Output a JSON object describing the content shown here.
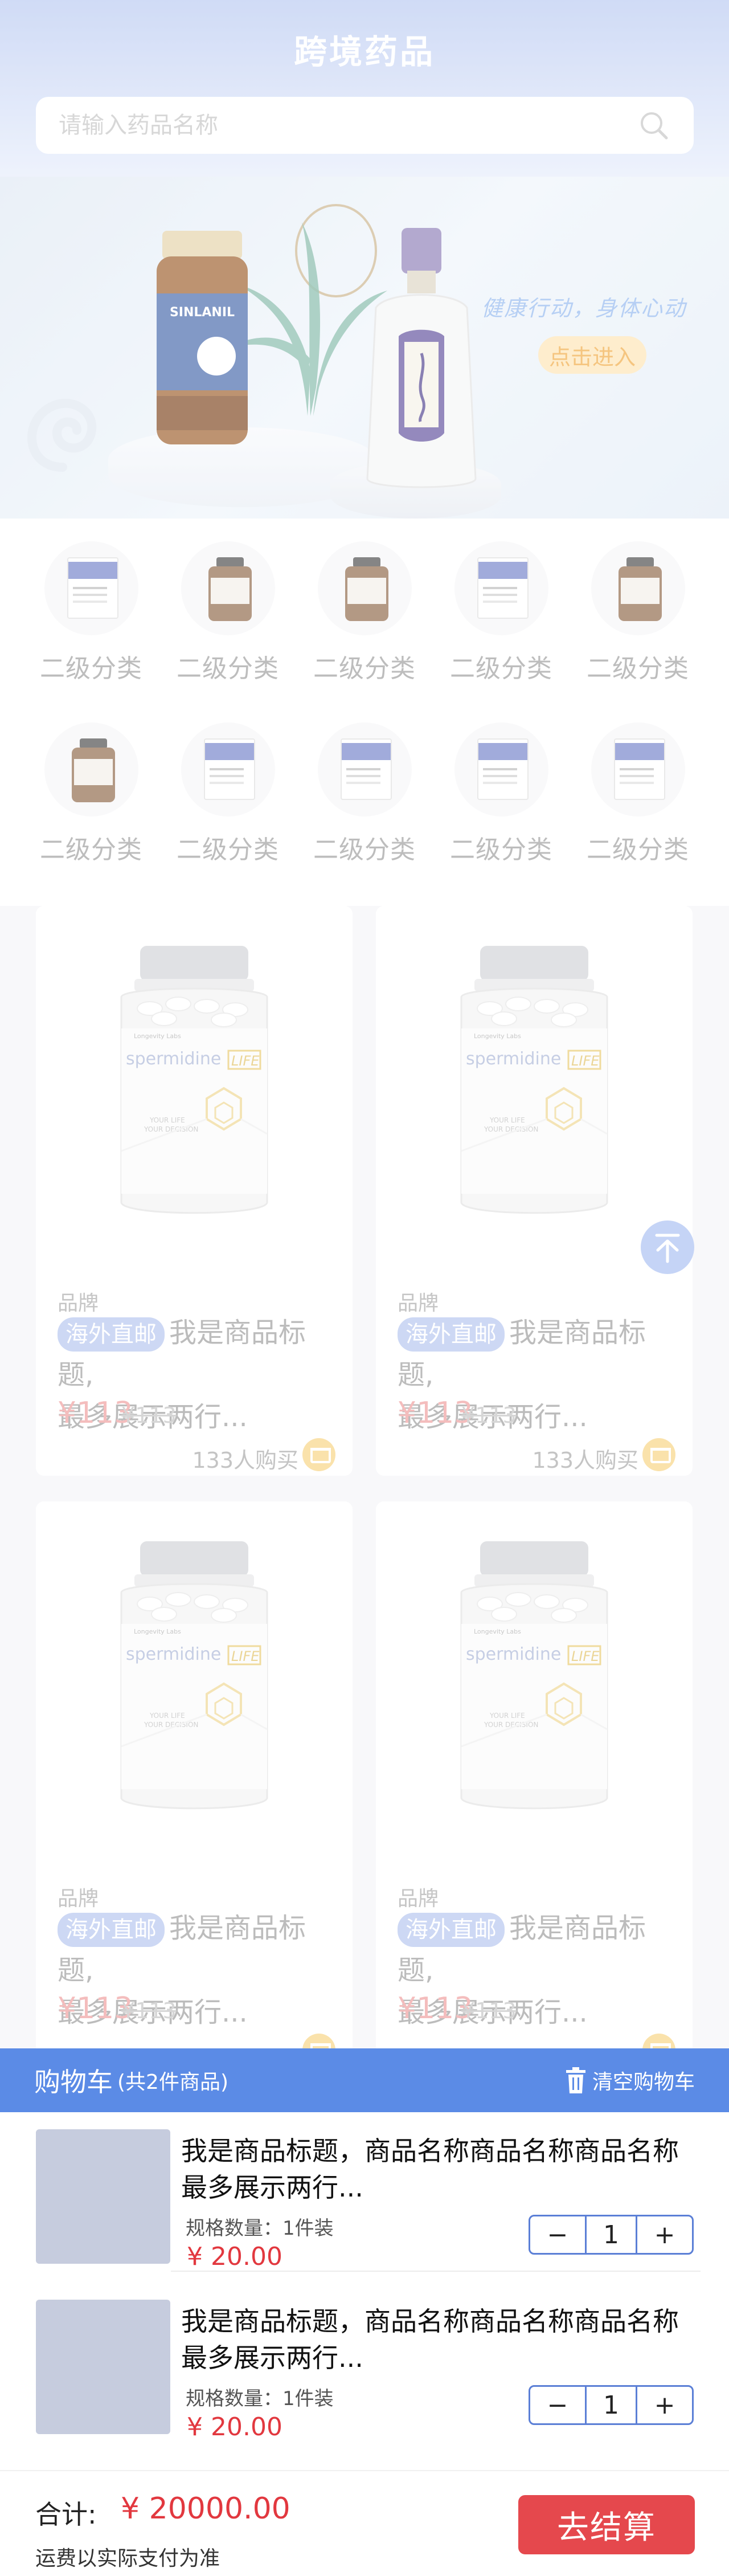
{
  "header": {
    "title": "跨境药品"
  },
  "search": {
    "placeholder": "请输入药品名称"
  },
  "banner": {
    "slogan": "健康行动，身体心动",
    "cta": "点击进入"
  },
  "categories": [
    {
      "label": "二级分类",
      "icon": "box"
    },
    {
      "label": "二级分类",
      "icon": "jar"
    },
    {
      "label": "二级分类",
      "icon": "jar"
    },
    {
      "label": "二级分类",
      "icon": "box"
    },
    {
      "label": "二级分类",
      "icon": "jar"
    },
    {
      "label": "二级分类",
      "icon": "jar"
    },
    {
      "label": "二级分类",
      "icon": "box"
    },
    {
      "label": "二级分类",
      "icon": "box"
    },
    {
      "label": "二级分类",
      "icon": "box"
    },
    {
      "label": "二级分类",
      "icon": "box"
    }
  ],
  "products": [
    {
      "brand": "品牌",
      "tag": "海外直邮",
      "title_line1": "我是商品标题,",
      "title_line2": "最多展示两行...",
      "price": "¥113",
      "old_price": "¥113",
      "buyers": "133人购买",
      "img_brand": "spermidine",
      "img_brand2": "LIFE",
      "img_line1": "YOUR LIFE",
      "img_line2": "YOUR DECISION",
      "img_maker": "Longevity Labs"
    },
    {
      "brand": "品牌",
      "tag": "海外直邮",
      "title_line1": "我是商品标题,",
      "title_line2": "最多展示两行...",
      "price": "¥113",
      "old_price": "¥113",
      "buyers": "133人购买",
      "img_brand": "spermidine",
      "img_brand2": "LIFE",
      "img_line1": "YOUR LIFE",
      "img_line2": "YOUR DECISION",
      "img_maker": "Longevity Labs"
    },
    {
      "brand": "品牌",
      "tag": "海外直邮",
      "title_line1": "我是商品标题,",
      "title_line2": "最多展示两行...",
      "price": "¥113",
      "old_price": "¥113",
      "buyers": "",
      "img_brand": "spermidine",
      "img_brand2": "LIFE",
      "img_line1": "YOUR LIFE",
      "img_line2": "YOUR DECISION",
      "img_maker": "Longevity Labs"
    },
    {
      "brand": "品牌",
      "tag": "海外直邮",
      "title_line1": "我是商品标题,",
      "title_line2": "最多展示两行...",
      "price": "¥113",
      "old_price": "¥113",
      "buyers": "",
      "img_brand": "spermidine",
      "img_brand2": "LIFE",
      "img_line1": "YOUR LIFE",
      "img_line2": "YOUR DECISION",
      "img_maker": "Longevity Labs"
    }
  ],
  "cart": {
    "title": "购物车",
    "count_text": "(共2件商品)",
    "clear_label": "清空购物车",
    "items": [
      {
        "name_line1": "我是商品标题，商品名称商品名称商品名称",
        "name_line2": "最多展示两行...",
        "spec": "规格数量：1件装",
        "price": "¥ 20.00",
        "qty": "1"
      },
      {
        "name_line1": "我是商品标题，商品名称商品名称商品名称",
        "name_line2": "最多展示两行...",
        "spec": "规格数量：1件装",
        "price": "¥ 20.00",
        "qty": "1"
      }
    ],
    "minus": "−",
    "plus": "+"
  },
  "footer": {
    "total_label": "合计:",
    "total_amount": "¥ 20000.00",
    "shipping_note": "运费以实际支付为准",
    "checkout_label": "去结算"
  },
  "colors": {
    "accent": "#5b8be6",
    "price": "#e2383f",
    "checkout": "#e5484d"
  }
}
